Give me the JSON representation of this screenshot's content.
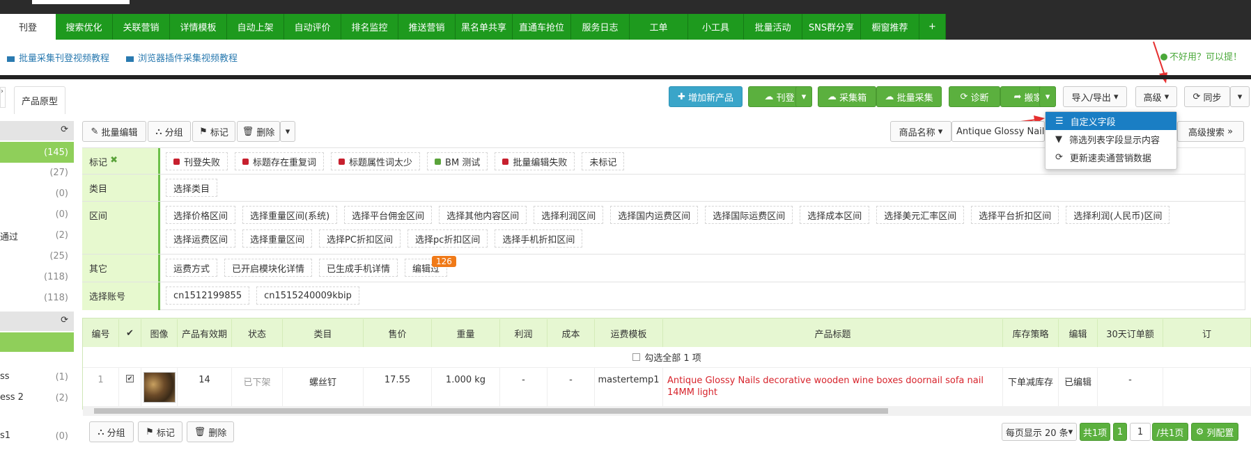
{
  "tabs": [
    "刊登",
    "搜索优化",
    "关联营销",
    "详情模板",
    "自动上架",
    "自动评价",
    "排名监控",
    "推送营销",
    "黑名单共享",
    "直通车抢位",
    "服务日志",
    "工单",
    "小工具",
    "批量活动",
    "SNS群分享",
    "橱窗推荐",
    "+"
  ],
  "links": [
    "批量采集刊登视频教程",
    "浏览器插件采集视频教程"
  ],
  "help_link": "不好用？可以提！",
  "subtab": "产品原型",
  "toolbar": {
    "add": "增加新产品",
    "publish": "刊登",
    "collect_box": "采集箱",
    "batch_collect": "批量采集",
    "diagnose": "诊断",
    "move": "搬家",
    "import_export": "导入/导出",
    "advanced": "高级",
    "sync": "同步"
  },
  "actions": {
    "batch_edit": "批量编辑",
    "group": "分组",
    "mark": "标记",
    "delete": "删除"
  },
  "search": {
    "field": "商品名称",
    "value": "Antique Glossy Nails",
    "adv": "高级搜索"
  },
  "dropdown": [
    "自定义字段",
    "筛选列表字段显示内容",
    "更新速卖通营销数据"
  ],
  "sidebar": {
    "counts": [
      "(145)",
      "(27)",
      "(0)",
      "(0)",
      "(2)",
      "(25)",
      "(118)",
      "(118)"
    ],
    "label1": "通过",
    "bottom": [
      {
        "l": "ss",
        "c": "(1)"
      },
      {
        "l": "ess 2",
        "c": "(2)"
      },
      {
        "l": "s1",
        "c": "(0)"
      }
    ]
  },
  "filters": {
    "mark_label": "标记",
    "marks": [
      "刊登失败",
      "标题存在重复词",
      "标题属性词太少",
      "BM 测试",
      "批量编辑失败",
      "未标记"
    ],
    "mark_colors": [
      "#c7202e",
      "#c7202e",
      "#c7202e",
      "#5aa33a",
      "#c7202e"
    ],
    "category_label": "类目",
    "category": "选择类目",
    "range_label": "区间",
    "ranges": [
      "选择价格区间",
      "选择重量区间(系统)",
      "选择平台佣金区间",
      "选择其他内容区间",
      "选择利润区间",
      "选择国内运费区间",
      "选择国际运费区间",
      "选择成本区间",
      "选择美元汇率区间",
      "选择平台折扣区间",
      "选择利润(人民币)区间",
      "选择运费区间",
      "选择重量区间",
      "选择PC折扣区间",
      "选择pc折扣区间",
      "选择手机折扣区间"
    ],
    "other_label": "其它",
    "others": [
      "运费方式",
      "已开启模块化详情",
      "已生成手机详情",
      "编辑过"
    ],
    "badge": "126",
    "account_label": "选择账号",
    "accounts": [
      "cn1512199855",
      "cn1515240009kbip"
    ]
  },
  "table": {
    "headers": [
      "编号",
      "✔",
      "图像",
      "产品有效期",
      "状态",
      "类目",
      "售价",
      "重量",
      "利润",
      "成本",
      "运费模板",
      "产品标题",
      "库存策略",
      "编辑",
      "30天订单额",
      "订"
    ],
    "select_all": "勾选全部 1 项",
    "row": {
      "no": "1",
      "days": "14",
      "status": "已下架",
      "category": "螺丝钉",
      "price": "17.55",
      "weight": "1.000 kg",
      "profit": "-",
      "cost": "-",
      "template": "mastertemp1",
      "title": "Antique Glossy Nails decorative wooden wine boxes doornail sofa nail 14MM light",
      "stock": "下单减库存",
      "edit": "已编辑",
      "orders": "-"
    }
  },
  "footer": {
    "group": "分组",
    "mark": "标记",
    "delete": "删除",
    "per_page": "每页显示 20 条",
    "total": "共1项",
    "page": "1",
    "page_input": "1",
    "of": "/共1页",
    "config": "列配置"
  }
}
